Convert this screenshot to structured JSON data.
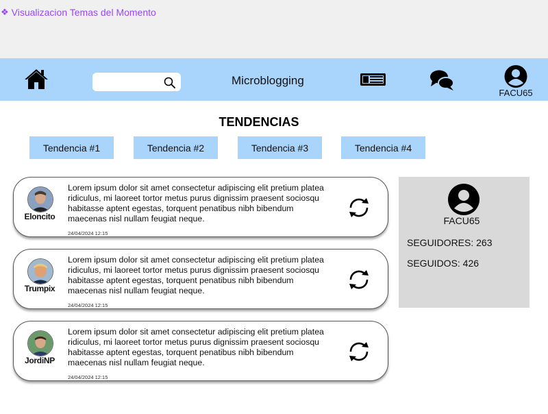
{
  "frame": {
    "label": "Visualizacion Temas del Momento"
  },
  "nav": {
    "title": "Microblogging",
    "search_placeholder": "",
    "user_label": "FACU65"
  },
  "trends": {
    "title": "TENDENCIAS",
    "items": [
      "Tendencia #1",
      "Tendencia #2",
      "Tendencia #3",
      "Tendencia #4"
    ]
  },
  "posts": [
    {
      "username": "Eloncito",
      "text": "Lorem ipsum dolor sit amet consectetur adipiscing elit pretium platea ridiculus, mi laoreet tortor metus purus dignissim praesent sociosqu habitasse aptent egestas, torquent penatibus nibh bibendum maecenas nisl nullam feugiat neque.",
      "date": "24/04/2024 12:15"
    },
    {
      "username": "Trumpix",
      "text": "Lorem ipsum dolor sit amet consectetur adipiscing elit pretium platea ridiculus, mi laoreet tortor metus purus dignissim praesent sociosqu habitasse aptent egestas, torquent penatibus nibh bibendum maecenas nisl nullam feugiat neque.",
      "date": "24/04/2024 12:15"
    },
    {
      "username": "JordiNP",
      "text": "Lorem ipsum dolor sit amet consectetur adipiscing elit pretium platea ridiculus, mi laoreet tortor metus purus dignissim praesent sociosqu habitasse aptent egestas, torquent penatibus nibh bibendum maecenas nisl nullam feugiat neque.",
      "date": "24/04/2024 12:15"
    }
  ],
  "profile": {
    "name": "FACU65",
    "followers": "SEGUIDORES: 263",
    "following": "SEGUIDOS: 426"
  },
  "colors": {
    "nav_bg": "#a9d4fb",
    "trend_bg": "#a9d4fb",
    "top_bg": "#f0f0f0",
    "card_bg": "#d9d9d9",
    "frame_label": "#9747ff"
  }
}
